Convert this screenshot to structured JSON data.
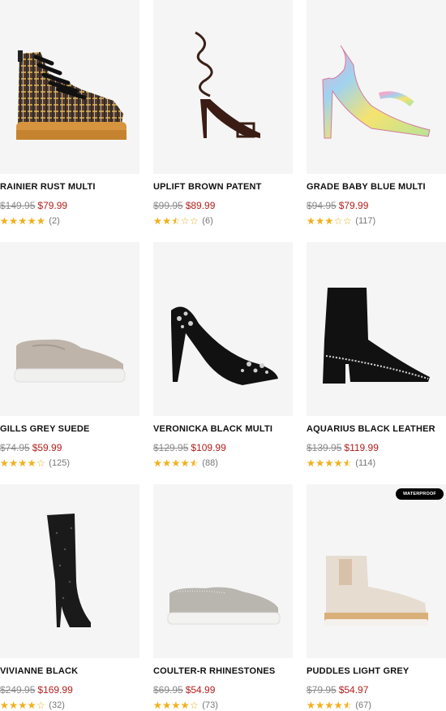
{
  "products": [
    {
      "name": "RAINIER RUST MULTI",
      "original_price": "$149.95",
      "sale_price": "$79.99",
      "rating": 5,
      "review_count": "(2)",
      "image": "plaid-hiking-boot",
      "badge": ""
    },
    {
      "name": "UPLIFT BROWN PATENT",
      "original_price": "$99.95",
      "sale_price": "$89.99",
      "rating": 2.5,
      "review_count": "(6)",
      "image": "lace-up-heel-sandal",
      "badge": ""
    },
    {
      "name": "GRADE BABY BLUE MULTI",
      "original_price": "$94.95",
      "sale_price": "$79.99",
      "rating": 3,
      "review_count": "(117)",
      "image": "multicolor-strappy-heel",
      "badge": ""
    },
    {
      "name": "GILLS GREY SUEDE",
      "original_price": "$74.95",
      "sale_price": "$59.99",
      "rating": 4,
      "review_count": "(125)",
      "image": "slip-on-sneaker",
      "badge": ""
    },
    {
      "name": "VERONICKA BLACK MULTI",
      "original_price": "$129.95",
      "sale_price": "$109.99",
      "rating": 4.5,
      "review_count": "(88)",
      "image": "embellished-pump",
      "badge": ""
    },
    {
      "name": "AQUARIUS BLACK LEATHER",
      "original_price": "$139.95",
      "sale_price": "$119.99",
      "rating": 4.5,
      "review_count": "(114)",
      "image": "studded-ankle-bootie",
      "badge": ""
    },
    {
      "name": "VIVIANNE BLACK",
      "original_price": "$249.95",
      "sale_price": "$169.99",
      "rating": 4,
      "review_count": "(32)",
      "image": "over-knee-boot",
      "badge": ""
    },
    {
      "name": "COULTER-R RHINESTONES",
      "original_price": "$69.95",
      "sale_price": "$54.99",
      "rating": 4,
      "review_count": "(73)",
      "image": "rhinestone-slip-on",
      "badge": ""
    },
    {
      "name": "PUDDLES LIGHT GREY",
      "original_price": "$79.95",
      "sale_price": "$54.97",
      "rating": 4.5,
      "review_count": "(67)",
      "image": "chelsea-rain-boot",
      "badge": "WATERPROOF"
    }
  ],
  "colors": {
    "sale": "#b3211e",
    "star": "#f2b01e",
    "image_bg": "#f5f5f5"
  }
}
